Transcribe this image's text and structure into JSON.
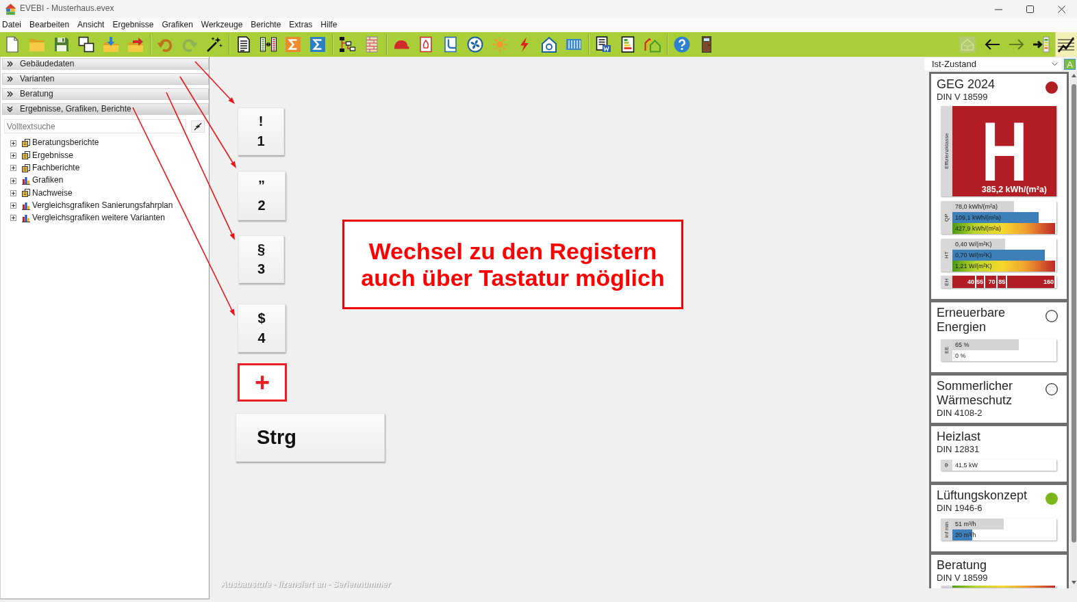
{
  "window": {
    "title": "EVEBI - Musterhaus.evex"
  },
  "menu": [
    "Datei",
    "Bearbeiten",
    "Ansicht",
    "Ergebnisse",
    "Grafiken",
    "Werkzeuge",
    "Berichte",
    "Extras",
    "Hilfe"
  ],
  "toolbar": {
    "groups": [
      [
        {
          "disabled": false
        },
        {
          "disabled": false
        },
        {
          "disabled": false
        },
        {
          "disabled": false
        },
        {
          "disabled": false
        },
        {
          "disabled": false
        }
      ],
      [
        {
          "disabled": false
        },
        {
          "disabled": true
        },
        {
          "disabled": false
        }
      ],
      [
        {
          "disabled": false
        },
        {
          "disabled": false
        },
        {
          "disabled": false
        },
        {
          "disabled": false
        }
      ],
      [
        {
          "disabled": false
        },
        {
          "disabled": false
        }
      ],
      [
        {
          "disabled": false
        },
        {
          "disabled": false
        },
        {
          "disabled": false
        },
        {
          "disabled": false
        },
        {
          "disabled": false
        },
        {
          "disabled": false
        },
        {
          "disabled": false
        },
        {
          "disabled": false
        }
      ],
      [
        {
          "disabled": false
        },
        {
          "disabled": false
        },
        {
          "disabled": false
        }
      ],
      [
        {
          "disabled": false
        },
        {
          "disabled": false
        }
      ]
    ],
    "right": [
      {
        "disabled": true,
        "pressed": false
      },
      {
        "disabled": false,
        "pressed": false
      },
      {
        "disabled": true,
        "pressed": false
      },
      {
        "disabled": false,
        "pressed": false
      },
      {
        "disabled": false,
        "pressed": true
      }
    ]
  },
  "sidebar": {
    "sections": [
      {
        "label": "Gebäudedaten",
        "expanded": false
      },
      {
        "label": "Varianten",
        "expanded": false
      },
      {
        "label": "Beratung",
        "expanded": false
      },
      {
        "label": "Ergebnisse, Grafiken, Berichte",
        "expanded": true,
        "search": {
          "placeholder": "Volltextsuche"
        },
        "tree": [
          {
            "label": "Beratungsberichte",
            "kind": "report",
            "expanded": false
          },
          {
            "label": "Ergebnisse",
            "kind": "report",
            "expanded": false
          },
          {
            "label": "Fachberichte",
            "kind": "report",
            "expanded": false
          },
          {
            "label": "Grafiken",
            "kind": "chart",
            "expanded": false
          },
          {
            "label": "Nachweise",
            "kind": "report",
            "expanded": false
          },
          {
            "label": "Vergleichsgrafiken Sanierungsfahrplan",
            "kind": "chart",
            "expanded": false
          },
          {
            "label": "Vergleichsgrafiken weitere Varianten",
            "kind": "chart",
            "expanded": false
          }
        ]
      }
    ]
  },
  "canvas": {
    "keys": [
      {
        "upper": "!",
        "lower": "1"
      },
      {
        "upper": "”",
        "lower": "2"
      },
      {
        "upper": "§",
        "lower": "3"
      },
      {
        "upper": "$",
        "lower": "4"
      }
    ],
    "plus": "+",
    "modifier_key": "Strg",
    "callout": "Wechsel zu den Registern auch über Tastatur möglich",
    "license_note": "Ausbaustufe - lizensiert an - Seriennummer"
  },
  "results_panel": {
    "variant": "Ist-Zustand",
    "variant_badge": "A",
    "cards": [
      {
        "title": "GEG 2024",
        "subtitle": "DIN V 18599",
        "indicator": {
          "kind": "filled",
          "color": "#b21e23"
        },
        "rating": {
          "label": "Effizienzklasse",
          "class": "H",
          "value": "385,2 kWh/(m²a)"
        },
        "groups": [
          {
            "label": "QP",
            "rows": [
              {
                "kind": "reference",
                "text": "78,0 kWh/(m²a)",
                "level": 0.6
              },
              {
                "kind": "actual",
                "text": "109,1 kWh/(m²a)",
                "level": 0.84
              },
              {
                "kind": "scale",
                "text": "427,9 kWh/(m²a)",
                "level": 1
              }
            ]
          },
          {
            "label": "HT",
            "rows": [
              {
                "kind": "reference",
                "text": "0,40 W/(m²K)",
                "level": 0.51
              },
              {
                "kind": "actual",
                "text": "0,70 W/(m²K)",
                "level": 0.9
              },
              {
                "kind": "scale",
                "text": "1,21 W/(m²K)",
                "level": 1
              }
            ]
          }
        ],
        "eh_scale": {
          "label": "EH",
          "steps": [
            "40",
            "55",
            "70",
            "85",
            "160"
          ]
        }
      },
      {
        "title": "Erneuerbare Energien",
        "indicator": {
          "kind": "empty"
        },
        "groups": [
          {
            "label": "EE",
            "rows": [
              {
                "kind": "reference",
                "text": "65 %",
                "level": 0.65
              },
              {
                "kind": "value",
                "text": "0 %"
              }
            ]
          }
        ]
      },
      {
        "title": "Sommerlicher Wärmeschutz",
        "subtitle": "DIN 4108-2",
        "indicator": {
          "kind": "empty"
        }
      },
      {
        "title": "Heizlast",
        "subtitle": "DIN 12831",
        "groups": [
          {
            "label": "Φ",
            "rows": [
              {
                "kind": "value",
                "text": "41,5 kW"
              }
            ]
          }
        ]
      },
      {
        "title": "Lüftungskonzept",
        "subtitle": "DIN 1946-6",
        "indicator": {
          "kind": "filled",
          "color": "#7cb518"
        },
        "groups": [
          {
            "label": "inf min",
            "rows": [
              {
                "kind": "reference",
                "text": "51 m³/h",
                "level": 0.5
              },
              {
                "kind": "actual",
                "text": "20 m³/h",
                "level": 0.19
              }
            ]
          }
        ]
      },
      {
        "title": "Beratung",
        "subtitle": "DIN V 18599",
        "bar_preview": {
          "level": 1
        }
      }
    ]
  }
}
